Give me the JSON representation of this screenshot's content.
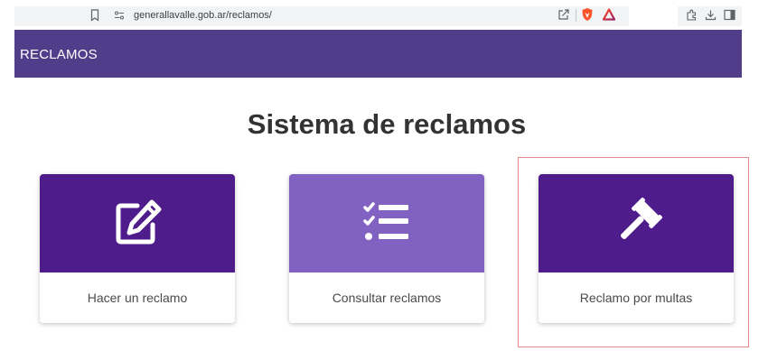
{
  "browser": {
    "url": "generallavalle.gob.ar/reclamos/"
  },
  "header": {
    "title": "RECLAMOS",
    "color": "#523d8a"
  },
  "page": {
    "title": "Sistema de reclamos"
  },
  "cards": [
    {
      "label": "Hacer un reclamo",
      "icon": "edit-icon",
      "color": "#4f1c8b"
    },
    {
      "label": "Consultar reclamos",
      "icon": "checklist-icon",
      "color": "#8162c3"
    },
    {
      "label": "Reclamo por multas",
      "icon": "gavel-icon",
      "color": "#4f1c8b"
    }
  ],
  "highlight_color": "#e58a8a"
}
